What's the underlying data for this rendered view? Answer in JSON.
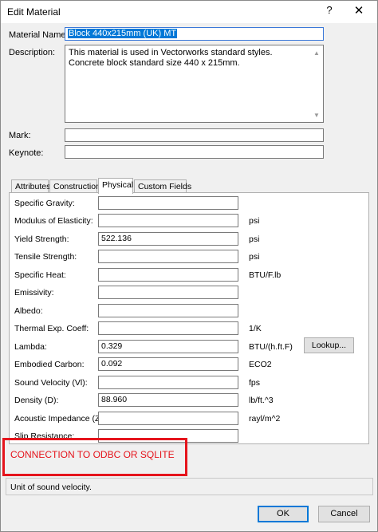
{
  "window": {
    "title": "Edit Material",
    "help_label": "?",
    "close_label": "✕"
  },
  "form": {
    "material_name_label": "Material Name:",
    "material_name_value": "Block 440x215mm (UK) MT",
    "description_label": "Description:",
    "description_value": "This material is used in Vectorworks standard styles. Concrete block standard size 440 x 215mm.",
    "mark_label": "Mark:",
    "mark_value": "",
    "keynote_label": "Keynote:",
    "keynote_value": ""
  },
  "tabs": [
    {
      "label": "Attributes"
    },
    {
      "label": "Construction"
    },
    {
      "label": "Physical"
    },
    {
      "label": "Custom Fields"
    }
  ],
  "active_tab": "Physical",
  "physical": {
    "rows": [
      {
        "label": "Specific Gravity:",
        "value": "",
        "unit": ""
      },
      {
        "label": "Modulus of Elasticity:",
        "value": "",
        "unit": "psi"
      },
      {
        "label": "Yield Strength:",
        "value": "522.136",
        "unit": "psi"
      },
      {
        "label": "Tensile Strength:",
        "value": "",
        "unit": "psi"
      },
      {
        "label": "Specific Heat:",
        "value": "",
        "unit": "BTU/F.lb"
      },
      {
        "label": "Emissivity:",
        "value": "",
        "unit": ""
      },
      {
        "label": "Albedo:",
        "value": "",
        "unit": ""
      },
      {
        "label": "Thermal Exp. Coeff:",
        "value": "",
        "unit": "1/K"
      },
      {
        "label": "Lambda:",
        "value": "0.329",
        "unit": "BTU/(h.ft.F)"
      },
      {
        "label": "Embodied Carbon:",
        "value": "0.092",
        "unit": "ECO2"
      },
      {
        "label": "Sound Velocity (Vl):",
        "value": "",
        "unit": "fps"
      },
      {
        "label": "Density (D):",
        "value": "88.960",
        "unit": "lb/ft.^3"
      },
      {
        "label": "Acoustic Impedance (Z):",
        "value": "",
        "unit": "rayl/m^2"
      },
      {
        "label": "Slip Resistance:",
        "value": "",
        "unit": ""
      }
    ],
    "lookup_label": "Lookup..."
  },
  "annotation": {
    "text": "CONNECTION TO ODBC OR SQLITE",
    "color": "#e5141c"
  },
  "hint": "Unit of sound velocity.",
  "footer": {
    "ok_label": "OK",
    "cancel_label": "Cancel"
  },
  "colors": {
    "selection": "#0078d7",
    "accent_border": "#0078d7"
  }
}
